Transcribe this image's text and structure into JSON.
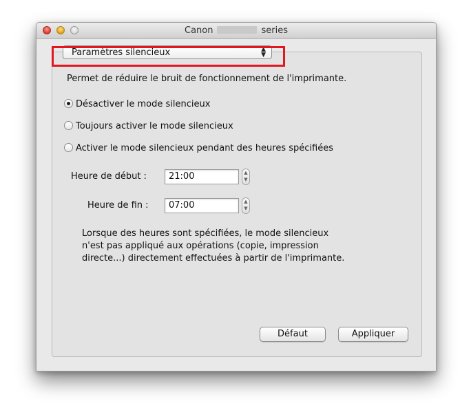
{
  "window": {
    "title_prefix": "Canon",
    "title_suffix": "series"
  },
  "popup": {
    "selected": "Paramètres silencieux",
    "arrows": "▲▼"
  },
  "description": "Permet de réduire le bruit de fonctionnement de l'imprimante.",
  "radios": [
    {
      "label": "Désactiver le mode silencieux",
      "selected": true
    },
    {
      "label": "Toujours activer le mode silencieux",
      "selected": false
    },
    {
      "label": "Activer le mode silencieux pendant des heures spécifiées",
      "selected": false
    }
  ],
  "start_time": {
    "label": "Heure de début :",
    "value": "21:00"
  },
  "end_time": {
    "label": "Heure de fin :",
    "value": "07:00"
  },
  "note_lines": [
    "Lorsque des heures sont spécifiées, le mode silencieux",
    "n'est pas appliqué aux opérations (copie, impression",
    "directe...) directement effectuées à partir de l'imprimante."
  ],
  "buttons": {
    "default": "Défaut",
    "apply": "Appliquer"
  },
  "colors": {
    "highlight": "#e3151f"
  }
}
